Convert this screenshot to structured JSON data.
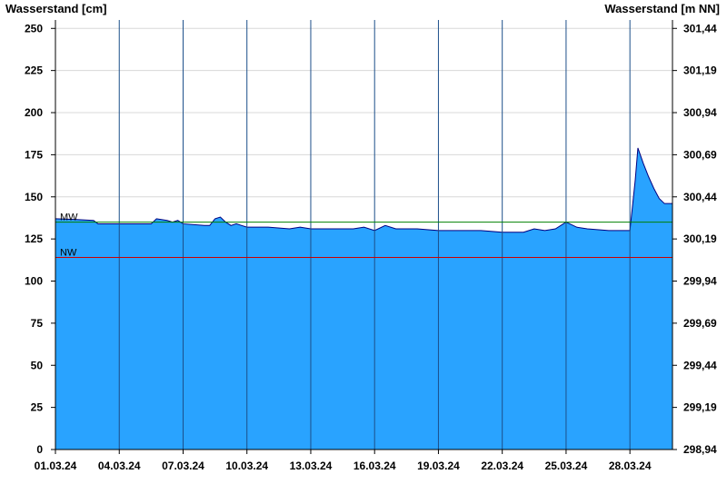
{
  "chart_data": {
    "type": "area",
    "ylabel_left": "Wasserstand [cm]",
    "ylabel_right": "Wasserstand [m NN]",
    "ylim": [
      0,
      255
    ],
    "xlim": [
      "2024-03-01T00:00",
      "2024-03-30T00:00"
    ],
    "y_ticks_left": [
      "0",
      "25",
      "50",
      "75",
      "100",
      "125",
      "150",
      "175",
      "200",
      "225",
      "250"
    ],
    "y_ticks_right": [
      "298,94",
      "299,19",
      "299,44",
      "299,69",
      "299,94",
      "300,19",
      "300,44",
      "300,69",
      "300,94",
      "301,19",
      "301,44"
    ],
    "x_ticks": [
      "01.03.24",
      "04.03.24",
      "07.03.24",
      "10.03.24",
      "13.03.24",
      "16.03.24",
      "19.03.24",
      "22.03.24",
      "25.03.24",
      "28.03.24"
    ],
    "grid": true,
    "reference_lines": [
      {
        "label": "MW",
        "value": 135,
        "color": "#008000"
      },
      {
        "label": "NW",
        "value": 114,
        "color": "#cc0000"
      }
    ],
    "series": [
      {
        "fill_color": "#29a3ff",
        "line_color": "#000080",
        "points": [
          [
            "2024-03-01T00:00",
            137
          ],
          [
            "2024-03-02T00:00",
            136.5
          ],
          [
            "2024-03-02T19:00",
            136
          ],
          [
            "2024-03-03T00:00",
            134
          ],
          [
            "2024-03-04T00:00",
            134
          ],
          [
            "2024-03-05T00:00",
            134
          ],
          [
            "2024-03-05T12:00",
            134
          ],
          [
            "2024-03-05T18:00",
            137
          ],
          [
            "2024-03-06T06:00",
            136
          ],
          [
            "2024-03-06T12:00",
            135
          ],
          [
            "2024-03-06T18:00",
            136
          ],
          [
            "2024-03-07T00:00",
            134
          ],
          [
            "2024-03-08T00:00",
            133
          ],
          [
            "2024-03-08T06:00",
            133
          ],
          [
            "2024-03-08T12:00",
            137
          ],
          [
            "2024-03-08T18:00",
            138
          ],
          [
            "2024-03-09T00:00",
            135
          ],
          [
            "2024-03-09T06:00",
            133
          ],
          [
            "2024-03-09T12:00",
            134
          ],
          [
            "2024-03-09T18:00",
            133
          ],
          [
            "2024-03-10T00:00",
            132
          ],
          [
            "2024-03-11T00:00",
            132
          ],
          [
            "2024-03-12T00:00",
            131
          ],
          [
            "2024-03-12T12:00",
            132
          ],
          [
            "2024-03-13T00:00",
            131
          ],
          [
            "2024-03-14T00:00",
            131
          ],
          [
            "2024-03-15T00:00",
            131
          ],
          [
            "2024-03-15T12:00",
            132
          ],
          [
            "2024-03-16T00:00",
            130
          ],
          [
            "2024-03-16T12:00",
            133
          ],
          [
            "2024-03-17T00:00",
            131
          ],
          [
            "2024-03-18T00:00",
            131
          ],
          [
            "2024-03-19T00:00",
            130
          ],
          [
            "2024-03-20T00:00",
            130
          ],
          [
            "2024-03-21T00:00",
            130
          ],
          [
            "2024-03-22T00:00",
            129
          ],
          [
            "2024-03-23T00:00",
            129
          ],
          [
            "2024-03-23T12:00",
            131
          ],
          [
            "2024-03-24T00:00",
            130
          ],
          [
            "2024-03-24T12:00",
            131
          ],
          [
            "2024-03-25T00:00",
            135
          ],
          [
            "2024-03-25T12:00",
            132
          ],
          [
            "2024-03-26T00:00",
            131
          ],
          [
            "2024-03-27T00:00",
            130
          ],
          [
            "2024-03-28T00:00",
            130
          ],
          [
            "2024-03-28T06:00",
            160
          ],
          [
            "2024-03-28T09:00",
            179
          ],
          [
            "2024-03-28T15:00",
            170
          ],
          [
            "2024-03-28T21:00",
            162
          ],
          [
            "2024-03-29T03:00",
            155
          ],
          [
            "2024-03-29T09:00",
            149
          ],
          [
            "2024-03-29T15:00",
            146
          ],
          [
            "2024-03-30T00:00",
            146
          ]
        ]
      }
    ]
  }
}
